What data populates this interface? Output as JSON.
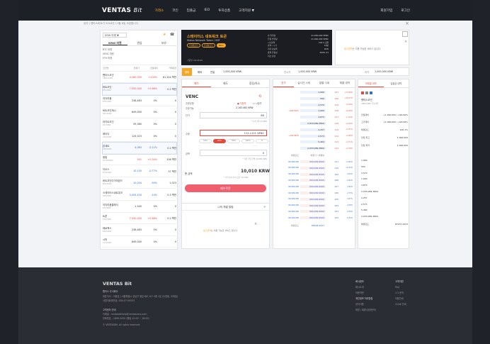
{
  "header": {
    "logo_main": "VENTAS",
    "logo_sub": "Bit",
    "nav": [
      "거래소",
      "코인",
      "입출금",
      "IEO",
      "투자상품",
      "고객지원 ▼"
    ],
    "right": [
      "회원가입",
      "로그인"
    ]
  },
  "notice": "공지 | 벤타스비트가 2018년 11월 8일 오픈합니다",
  "coinlist": {
    "market_select": "KRW 마켓 ▼",
    "tabs": [
      "KRW 마켓",
      "관심",
      "보유"
    ],
    "markets": [
      "BTC 마켓",
      "VENC 마켓",
      "ETH 마켓"
    ],
    "columns": [
      "코인명",
      "현재가",
      "전일대비",
      "거래대금"
    ],
    "rows": [
      {
        "name": "벤타스코인",
        "code": "VENC/KRW",
        "price": "4,260,000",
        "change": "+100%",
        "vol": "61,324 백만",
        "cls": "up"
      },
      {
        "name": "비트코인",
        "code": "BTC/KRW",
        "price": "7,550,000",
        "change": "+0.68%",
        "vol": "0.2 백만",
        "cls": "up"
      },
      {
        "name": "이더리움",
        "code": "ETH/KRW",
        "price": "238,483",
        "change": "0%",
        "vol": "0",
        "cls": "neu"
      },
      {
        "name": "비트코인캐시",
        "code": "BCH/KRW",
        "price": "649,000",
        "change": "0%",
        "vol": "0",
        "cls": "neu"
      },
      {
        "name": "라이트코인",
        "code": "LTC/KRW",
        "price": "59,380",
        "change": "0%",
        "vol": "0",
        "cls": "neu"
      },
      {
        "name": "에이다",
        "code": "ADA/KRW",
        "price": "124,023",
        "change": "0%",
        "vol": "0",
        "cls": "neu"
      },
      {
        "name": "온네트",
        "code": "ONT/KRW",
        "price": "4,063",
        "change": "-5.11%",
        "vol": "0.2 백만",
        "cls": "dn"
      },
      {
        "name": "퀀텀",
        "code": "QTUM/KRW",
        "price": "591",
        "change": "+0.34%",
        "vol": "106 백만",
        "cls": "up"
      },
      {
        "name": "이오스",
        "code": "EOS/KRW",
        "price": "10,100",
        "change": "-0.77%",
        "vol": "37 백만",
        "cls": "dn"
      },
      {
        "name": "비트코인다이아몬드",
        "code": "BCD/KRW",
        "price": "10,034",
        "change": "-50%",
        "vol": "1,023",
        "cls": "dn"
      },
      {
        "name": "스테이터스네트워크",
        "code": "SNT/KRW",
        "price": "3,454,434",
        "change": "-14%",
        "vol": "0.3 백만",
        "cls": "dn"
      },
      {
        "name": "이더리움클래식",
        "code": "ETC/KRW",
        "price": "1,540",
        "change": "0%",
        "vol": "0",
        "cls": "neu"
      },
      {
        "name": "트론",
        "code": "TRX/KRW",
        "price": "7,550,000",
        "change": "+0.68%",
        "vol": "0.2 백만",
        "cls": "up"
      },
      {
        "name": "제로엑스",
        "code": "ZRX/KRW",
        "price": "238,483",
        "change": "0%",
        "vol": "0",
        "cls": "neu"
      },
      {
        "name": "시빅",
        "code": "CVC/KRW",
        "price": "649,000",
        "change": "0%",
        "vol": "0",
        "cls": "neu"
      }
    ]
  },
  "coininfo": {
    "title": "스테이터스 네트워크 토큰",
    "subtitle": "Status Network Token / SNT",
    "tags": [
      "플랫폼코인",
      "플랫폼코인",
      "NO.1"
    ],
    "date": "기준일: 09:26:00",
    "stat_labels": [
      "총 발행량",
      "유통 발행량",
      "시가총액",
      "총액 / 시가",
      "최대 상승폭",
      "종목 유동성",
      "최초 상장"
    ],
    "stat_values": [
      "21,000,000 VENC",
      "21,000,000 VENC",
      "125.4 조원",
      "15분",
      "PoW",
      "2009. 01",
      ""
    ]
  },
  "ad": {
    "highlight": "광고영역",
    "message": "는 이용 가능한 서비스 입니다."
  },
  "strip": {
    "tabs": [
      "원화",
      "해외",
      "전일"
    ],
    "left_value": "1,000,000 KRW",
    "mid_label": "전시가",
    "mid_value": "1,000,000 KRW",
    "right_label": "저가",
    "right_value": "1,000,000 KRW"
  },
  "order": {
    "tabs": [
      "매수",
      "매도",
      "정정/취소"
    ],
    "coin": "VENC",
    "type_label": "주문유형",
    "radio1": "● 지정가",
    "radio2": "○ 시장가",
    "avail_label": "주문가능",
    "avail_value": "2,163,462 KRW",
    "price_label": "단가",
    "price_value": "80",
    "price_note": "* 호가단위 10 KRW",
    "qty_label": "수량",
    "qty_value": "111.1111 VENC",
    "pct": [
      "10%",
      "25%",
      "50%",
      "100%",
      "%"
    ],
    "amount_label": "금액",
    "amount_value": "0",
    "amount_note": "* 최소 주문금액 10,000 KRW",
    "total_label": "총 금액",
    "total_value": "10,010 KRW",
    "total_note": "* 수수료(0.1%) 포함 10 KRW",
    "buy_button": "매수주문",
    "alarm_title": "나의 체결 알림",
    "alarm_highlight": "광고영역",
    "alarm_message": "는 이용 가능한 서비스 입니다."
  },
  "book": {
    "tabs": [
      "호가",
      "실시간 시세",
      "일별 시세",
      "체결 내역"
    ],
    "asks": [
      {
        "q": "1,000",
        "p": "121",
        "c": "+31.99%"
      },
      {
        "q": "500",
        "p": "120",
        "c": "+10.27%"
      },
      {
        "q": "2,570",
        "p": "119",
        "c": "+9.29%"
      },
      {
        "q": "1,000",
        "p": "118",
        "c": "+8.36%"
      },
      {
        "q": "3,873",
        "p": "117",
        "c": "+7.44%"
      },
      {
        "q": "2,933,089.3809",
        "p": "116",
        "c": "+6.50%"
      },
      {
        "q": "2,257",
        "p": "115",
        "c": "+5.57%"
      },
      {
        "q": "2,573",
        "p": "114",
        "c": "+4.66%"
      },
      {
        "q": "5,464",
        "p": "113",
        "c": "+3.71%"
      },
      {
        "q": "2,933,089.3809",
        "p": "112",
        "c": "+2.78%"
      }
    ],
    "ask_side_labels": [
      "+999.999%",
      "+999.999%"
    ],
    "mid_left": "체결강도",
    "mid_right": "체결가 / 체결량",
    "bids": [
      {
        "q": "999,999.9999",
        "p": "111",
        "c": "+1.85%"
      },
      {
        "q": "999,999.9999",
        "p": "110",
        "c": "+0.93%"
      },
      {
        "q": "999,999.9999",
        "p": "109",
        "c": "0.00%"
      },
      {
        "q": "999,999.9999",
        "p": "108",
        "c": "-0.92%"
      },
      {
        "q": "999,999.9999",
        "p": "107",
        "c": "-1.84%"
      },
      {
        "q": "999,999.9999",
        "p": "106",
        "c": "-2.75%"
      },
      {
        "q": "999,999.9999",
        "p": "105",
        "c": "-3.67%"
      },
      {
        "q": "999,999.9999",
        "p": "104",
        "c": "-4.58%"
      },
      {
        "q": "999,999.9999",
        "p": "103",
        "c": "-5.50%"
      },
      {
        "q": "999,999.9999",
        "p": "102",
        "c": "-6.42%"
      }
    ],
    "bid_left": "99,999,999",
    "bid_right_vals": [
      "1,000",
      "500",
      "2,570",
      "1,000",
      "3,873",
      "2,933,089.3809",
      "2,257",
      "2,573",
      "5,464",
      "2,933,089.3809"
    ],
    "foot_left": "체결강도",
    "foot_mid": "89948.9427",
    "foot_right": "체결강도",
    "foot_right_val": "87937.2023"
  },
  "rinfo": {
    "tabs": [
      "미체결 내역",
      "입출금 내역"
    ],
    "coin_name": "벤타스코인",
    "coin_sub": "VENC/KRW 주문내역",
    "labels": [
      "전일대비",
      "고가대비",
      "체결강도",
      "당일 최고",
      "당일 최저"
    ],
    "values": [
      "+1,000,000 / +99.99%",
      "+1,000,000 / +99.99%",
      "100.1%",
      "1,000,000",
      "1,000,000"
    ]
  },
  "footer": {
    "logo": "VENTAS Bit",
    "company": "벤타스 주식회사",
    "addr1": "대표이사 : 이종호  |  서울특별시 강남구 봉은사로 107 4층 1호 (논현동, 도파빌)",
    "addr2": "사업자등록번호: 000-07-00533",
    "cs_title": "고객센터 안내",
    "cs1": "이메일 : ventasbithelp@ventascorp.com",
    "cs2": "전화번호 : 1899-2059 (평일 10:00 ~ 18:00)",
    "copyright": "© VENTASBit. All rights reserved.",
    "col1_title": "회사정보",
    "col1": [
      "회사소개",
      "이용약관",
      "개인정보 처리방침",
      "공지사항",
      "회원 / 제휴(상장문의)"
    ],
    "col2_title": "고객지원",
    "col2": [
      "FAQ",
      "1:1 문의",
      "이용안내",
      "수수료 안내"
    ]
  }
}
